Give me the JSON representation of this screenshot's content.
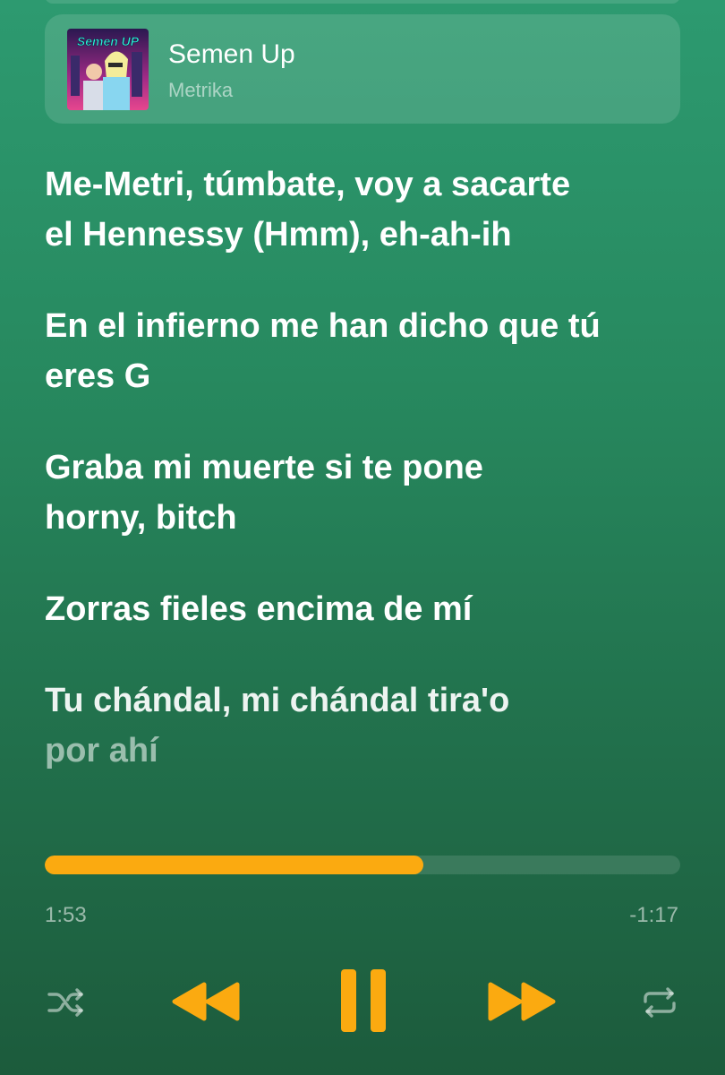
{
  "now_playing": {
    "title": "Semen Up",
    "artist": "Metrika",
    "cover_text": "Semen UP"
  },
  "lyrics": [
    "Me-Metri, túmbate, voy a sacarte\nel Hennessy (Hmm), eh-ah-ih",
    "En el infierno me han dicho que tú\neres G",
    "Graba mi muerte si te pone\nhorny, bitch",
    "Zorras fieles encima de mí",
    "Tu chándal, mi chándal tira'o"
  ],
  "lyrics_tail": "por ahí",
  "playback": {
    "elapsed": "1:53",
    "remaining": "-1:17",
    "progress_fraction": 0.596
  },
  "controls": {
    "shuffle": "shuffle-icon",
    "previous": "rewind-icon",
    "play_pause": "pause-icon",
    "next": "fast-forward-icon",
    "repeat": "repeat-icon"
  },
  "colors": {
    "accent": "#fbaa10",
    "background_top": "#2d9a70",
    "background_bottom": "#1c5b3c"
  }
}
